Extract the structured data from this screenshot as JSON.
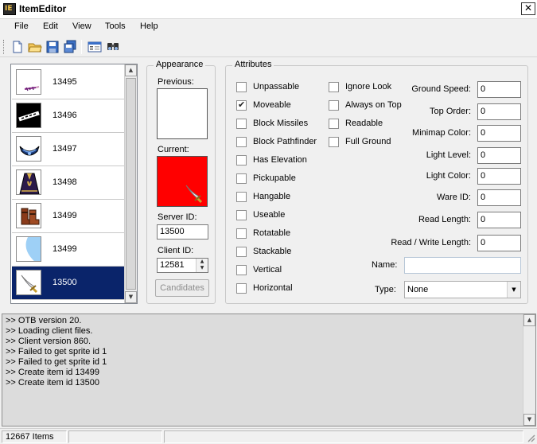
{
  "window": {
    "title": "ItemEditor",
    "icon_text": "IE",
    "close_label": "✕"
  },
  "menu": {
    "items": [
      "File",
      "Edit",
      "View",
      "Tools",
      "Help"
    ]
  },
  "toolbar": {
    "buttons": [
      "new-file-icon",
      "open-folder-icon",
      "save-icon",
      "save-as-icon",
      "properties-icon",
      "find-icon"
    ]
  },
  "item_list": {
    "items": [
      {
        "id": "13495",
        "sprite": "dagger"
      },
      {
        "id": "13496",
        "sprite": "scroll-text"
      },
      {
        "id": "13497",
        "sprite": "amulet"
      },
      {
        "id": "13498",
        "sprite": "robe"
      },
      {
        "id": "13499",
        "sprite": "boots"
      },
      {
        "id": "13499",
        "sprite": "blank-light"
      },
      {
        "id": "13500",
        "sprite": "scimitar",
        "selected": true
      }
    ],
    "scroll_up": "▲",
    "scroll_down": "▼"
  },
  "appearance": {
    "legend": "Appearance",
    "previous_label": "Previous:",
    "current_label": "Current:",
    "current_bg": "#ff0000",
    "server_id_label": "Server ID:",
    "server_id": "13500",
    "client_id_label": "Client ID:",
    "client_id": "12581",
    "candidates_label": "Candidates"
  },
  "attributes": {
    "legend": "Attributes",
    "col1": [
      {
        "label": "Unpassable",
        "checked": false
      },
      {
        "label": "Moveable",
        "checked": true
      },
      {
        "label": "Block Missiles",
        "checked": false
      },
      {
        "label": "Block Pathfinder",
        "checked": false
      },
      {
        "label": "Has Elevation",
        "checked": false
      },
      {
        "label": "Pickupable",
        "checked": false
      },
      {
        "label": "Hangable",
        "checked": false
      },
      {
        "label": "Useable",
        "checked": false
      },
      {
        "label": "Rotatable",
        "checked": false
      },
      {
        "label": "Stackable",
        "checked": false
      },
      {
        "label": "Vertical",
        "checked": false
      },
      {
        "label": "Horizontal",
        "checked": false
      }
    ],
    "col2": [
      {
        "label": "Ignore Look",
        "checked": false
      },
      {
        "label": "Always on Top",
        "checked": false
      },
      {
        "label": "Readable",
        "checked": false
      },
      {
        "label": "Full Ground",
        "checked": false
      }
    ],
    "fields": [
      {
        "label": "Ground Speed:",
        "value": "0"
      },
      {
        "label": "Top Order:",
        "value": "0"
      },
      {
        "label": "Minimap Color:",
        "value": "0"
      },
      {
        "label": "Light Level:",
        "value": "0"
      },
      {
        "label": "Light Color:",
        "value": "0"
      },
      {
        "label": "Ware ID:",
        "value": "0"
      },
      {
        "label": "Read Length:",
        "value": "0"
      },
      {
        "label": "Read / Write Length:",
        "value": "0"
      }
    ],
    "name_label": "Name:",
    "name_value": "",
    "type_label": "Type:",
    "type_value": "None"
  },
  "log": {
    "lines": [
      ">> OTB version 20.",
      ">> Loading client files.",
      ">> Client version 860.",
      ">> Failed to get sprite id 1",
      ">> Failed to get sprite id 1",
      ">> Create item id 13499",
      ">> Create item id 13500"
    ]
  },
  "status": {
    "item_count": "12667 Items"
  }
}
